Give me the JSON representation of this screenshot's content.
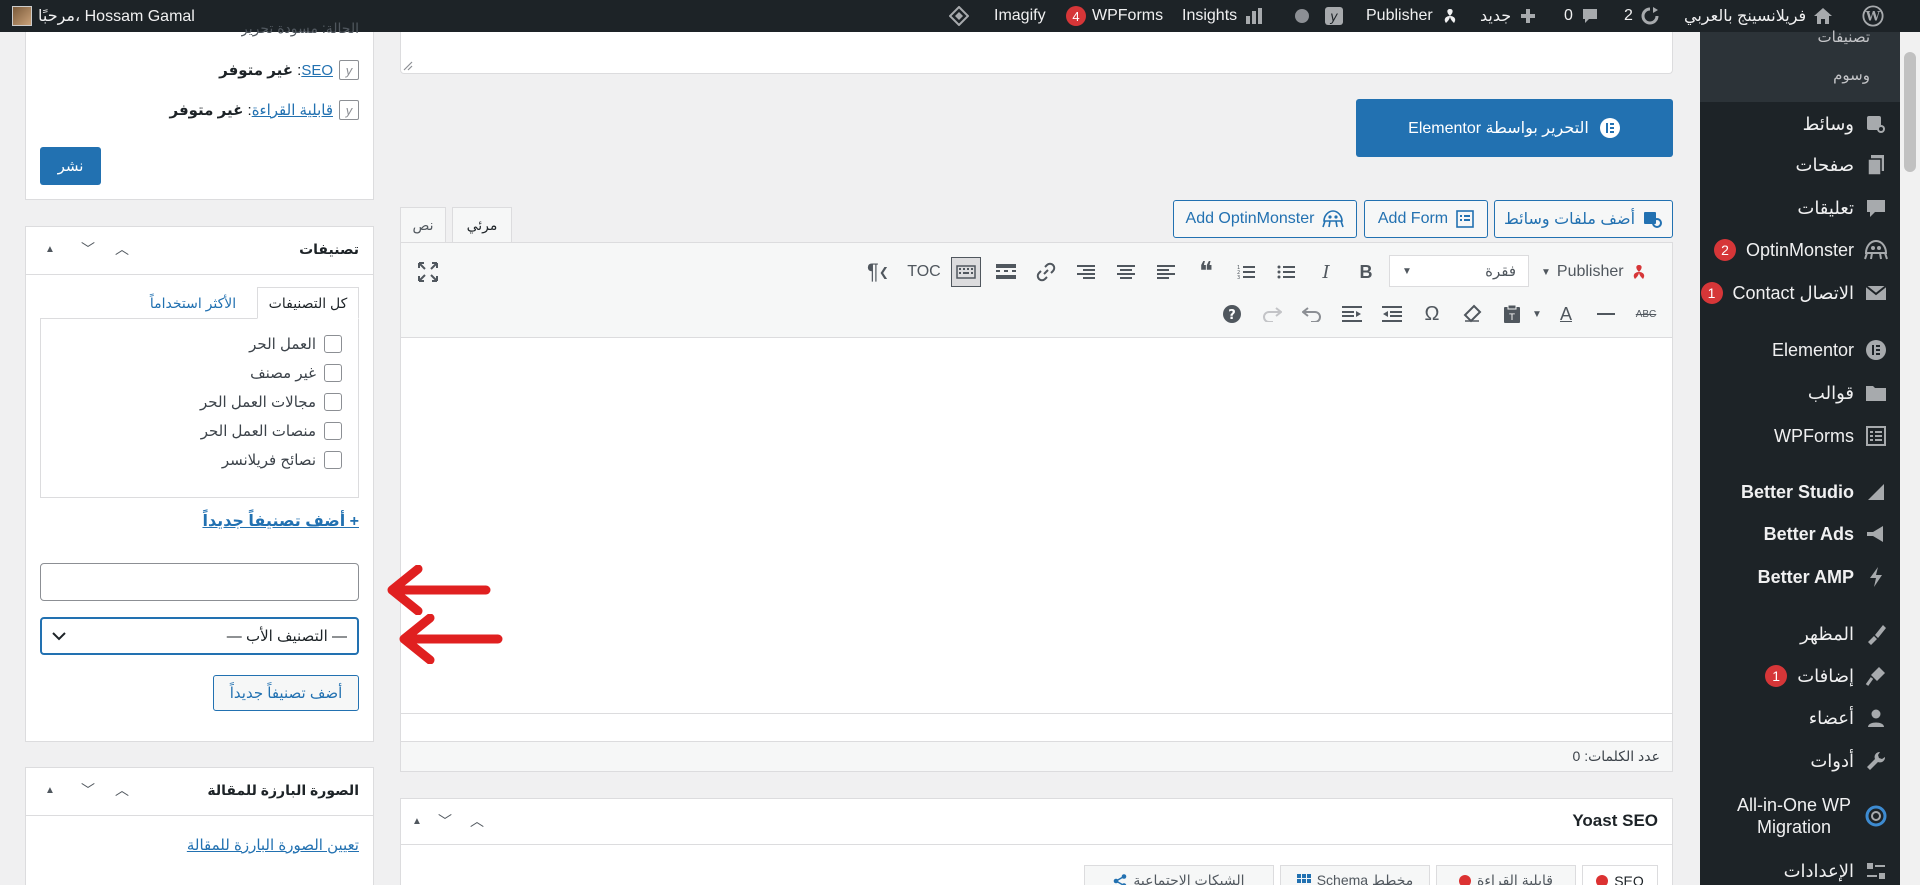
{
  "admin_bar": {
    "site_name": "فريلانسينج بالعربي",
    "updates_count": "2",
    "comments_count": "0",
    "new_label": "جديد",
    "publisher_label": "Publisher",
    "insights_label": "Insights",
    "wpforms_label": "WPForms",
    "wpforms_badge": "4",
    "imagify_label": "Imagify",
    "greeting": "مرحبًا، Hossam Gamal"
  },
  "sidebar": {
    "submenu": [
      {
        "label": "تصنيفات"
      },
      {
        "label": "وسوم"
      }
    ],
    "items": [
      {
        "label": "وسائط",
        "icon": "media-icon"
      },
      {
        "label": "صفحات",
        "icon": "pages-icon"
      },
      {
        "label": "تعليقات",
        "icon": "comments-icon"
      },
      {
        "label": "OptinMonster",
        "icon": "optinmonster-icon",
        "badge": "2"
      },
      {
        "label": "الاتصال Contact",
        "icon": "mail-icon",
        "badge": "1"
      },
      {
        "label": "Elementor",
        "icon": "elementor-icon"
      },
      {
        "label": "قوالب",
        "icon": "folder-icon"
      },
      {
        "label": "WPForms",
        "icon": "wpforms-icon"
      },
      {
        "label": "Better Studio",
        "icon": "better-studio-icon"
      },
      {
        "label": "Better Ads",
        "icon": "better-ads-icon"
      },
      {
        "label": "Better AMP",
        "icon": "better-amp-icon"
      },
      {
        "label": "المظهر",
        "icon": "appearance-icon"
      },
      {
        "label": "إضافات",
        "icon": "plugins-icon",
        "badge": "1"
      },
      {
        "label": "أعضاء",
        "icon": "users-icon"
      },
      {
        "label": "أدوات",
        "icon": "tools-icon"
      },
      {
        "label": "All-in-One WP Migration",
        "icon": "migration-icon"
      },
      {
        "label": "الإعدادات",
        "icon": "settings-icon"
      }
    ]
  },
  "editor": {
    "elementor_button": "التحرير بواسطة Elementor",
    "add_media": "أضف ملفات وسائط",
    "add_form": "Add Form",
    "add_optinmonster": "Add OptinMonster",
    "tab_visual": "مرئي",
    "tab_text": "نص",
    "publisher_label": "Publisher",
    "format_select": "فقرة",
    "toc_label": "TOC",
    "word_count": "عدد الكلمات: 0"
  },
  "yoast": {
    "title": "Yoast SEO",
    "tabs": [
      "SEO",
      "قابلية القراءة",
      "Schema مخطط",
      "الشبكات الاجتماعية"
    ]
  },
  "publish_box": {
    "partial_top": "الحالة: مسودة تحرير",
    "seo_label": "SEO",
    "seo_value": "غير متوفر",
    "readability_label": "قابلية القراءة",
    "readability_value": "غير متوفر",
    "publish_button": "نشر"
  },
  "categories_box": {
    "title": "تصنيفات",
    "tab_all": "كل التصنيفات",
    "tab_popular": "الأكثر استخداماً",
    "items": [
      {
        "label": "العمل الحر",
        "checked": false
      },
      {
        "label": "غير مصنف",
        "checked": false
      },
      {
        "label": "مجالات العمل الحر",
        "checked": false
      },
      {
        "label": "منصات العمل الحر",
        "checked": false
      },
      {
        "label": "نصائح فريلانسر",
        "checked": false
      }
    ],
    "add_new_link": "+ أضف تصنيفاً جديداً",
    "new_category_value": "",
    "parent_select": "— التصنيف الأب —",
    "add_button": "أضف تصنيفاً جديداً"
  },
  "featured_box": {
    "title": "الصورة البارزة للمقالة",
    "set_link": "تعيين الصورة البارزة للمقالة"
  },
  "colors": {
    "accent": "#2271b1",
    "admin_dark": "#1d2327",
    "badge_red": "#d63638",
    "annotation_red": "#e02020"
  }
}
